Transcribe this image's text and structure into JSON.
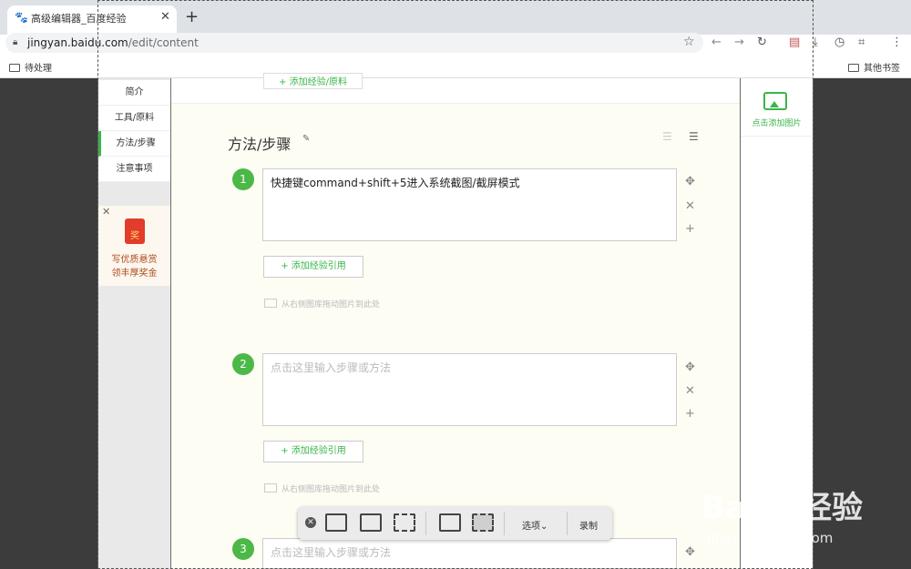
{
  "browser": {
    "tab_title": "高级编辑器_百度经验",
    "url_host": "jingyan.baidu.com",
    "url_path": "/edit/content",
    "bookmarks": [
      "待处理",
      "其他书签"
    ]
  },
  "sidebar": {
    "items": [
      "简介",
      "工具/原料",
      "方法/步骤",
      "注意事项"
    ],
    "active": "方法/步骤",
    "promo_line1": "写优质悬赏",
    "promo_line2": "领丰厚奖金",
    "promo_badge": "奖"
  },
  "main": {
    "top_button": "+ 添加经验/原料",
    "section_title": "方法/步骤",
    "steps": [
      {
        "number": "1",
        "text": "快捷键command+shift+5进入系统截图/截屏模式",
        "ref_button": "+ 添加经验引用",
        "drag_hint": "从右侧图库拖动图片到此处"
      },
      {
        "number": "2",
        "text": "点击这里输入步骤或方法",
        "ref_button": "+ 添加经验引用",
        "drag_hint": "从右侧图库拖动图片到此处"
      },
      {
        "number": "3",
        "text": "点击这里输入步骤或方法"
      }
    ]
  },
  "right_panel": {
    "add_image_label": "点击添加图片"
  },
  "screenshot_toolbar": {
    "options_label": "选项",
    "record_label": "录制"
  },
  "watermark": {
    "logo": "Baidu经验",
    "url": "jingyan.baidu.com"
  }
}
